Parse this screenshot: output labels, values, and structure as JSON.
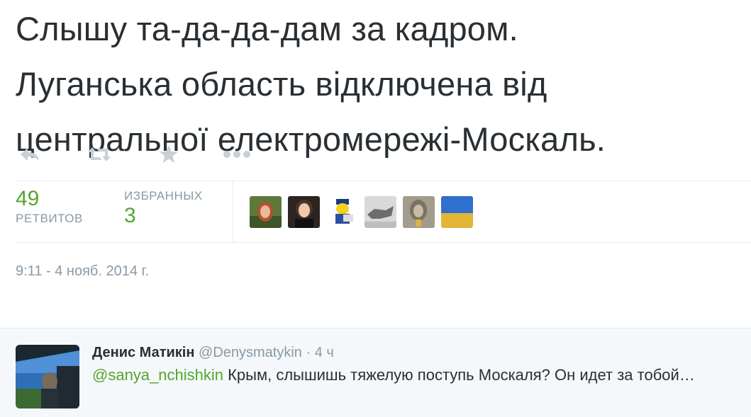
{
  "tweet": {
    "text_lines": [
      "Слышу та-да-да-дам за кадром.",
      "Луганська область відключена від",
      "центральної електромережі-Москаль."
    ]
  },
  "actions": [
    {
      "icon": "reply-icon"
    },
    {
      "icon": "retweet-icon"
    },
    {
      "icon": "favorite-star-icon"
    },
    {
      "icon": "more-dots-icon"
    }
  ],
  "stats": {
    "retweets_value": "49",
    "retweets_label": "РЕТВИТОВ",
    "favorites_label": "ИЗБРАННЫХ",
    "favorites_value": "3"
  },
  "timestamp": "9:11 - 4 нояб. 2014 г.",
  "reply": {
    "name": "Денис Матикін",
    "handle": "@Denysmatykin",
    "separator": "·",
    "time": "4 ч",
    "mention": "@sanya_nchishkin",
    "text": " Крым, слышишь тяжелую поступь Москаля? Он идет за тобой…"
  },
  "colors": {
    "accent_green": "#55a52f",
    "muted_gray": "#8899a6",
    "text": "#292f33",
    "reply_bg": "#f5f8fa"
  }
}
